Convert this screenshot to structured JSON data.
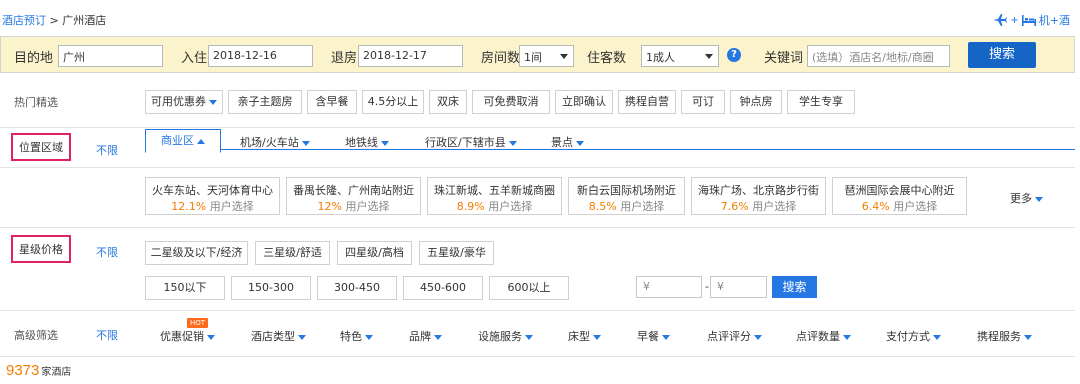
{
  "breadcrumb": {
    "link": "酒店预订",
    "separator": ">",
    "current": "广州酒店"
  },
  "header_right": {
    "label": "机+酒",
    "icons": [
      "airplane-icon",
      "bed-icon"
    ]
  },
  "search": {
    "destination_label": "目的地",
    "destination_value": "广州",
    "checkin_label": "入住",
    "checkin_value": "2018-12-16",
    "checkout_label": "退房",
    "checkout_value": "2018-12-17",
    "rooms_label": "房间数",
    "rooms_value": "1间",
    "guests_label": "住客数",
    "guests_value": "1成人",
    "keyword_label": "关键词",
    "keyword_placeholder": "(选填）酒店名/地标/商圈",
    "search_button": "搜索"
  },
  "hot": {
    "label": "热门精选",
    "chips": [
      "可用优惠券",
      "亲子主题房",
      "含早餐",
      "4.5分以上",
      "双床",
      "可免费取消",
      "立即确认",
      "携程自营",
      "可订",
      "钟点房",
      "学生专享"
    ]
  },
  "location": {
    "label": "位置区域",
    "unlimited": "不限",
    "tabs": [
      "商业区",
      "机场/火车站",
      "地铁线",
      "行政区/下辖市县",
      "景点"
    ],
    "user_choice_suffix": "用户选择",
    "areas": [
      {
        "name": "火车东站、天河体育中心",
        "percent": "12.1%"
      },
      {
        "name": "番禺长隆、广州南站附近",
        "percent": "12%"
      },
      {
        "name": "珠江新城、五羊新城商圈",
        "percent": "8.9%"
      },
      {
        "name": "新白云国际机场附近",
        "percent": "8.5%"
      },
      {
        "name": "海珠广场、北京路步行街",
        "percent": "7.6%"
      },
      {
        "name": "琶洲国际会展中心附近",
        "percent": "6.4%"
      }
    ],
    "more": "更多"
  },
  "star_price": {
    "label": "星级价格",
    "unlimited": "不限",
    "stars": [
      "二星级及以下/经济",
      "三星级/舒适",
      "四星级/高档",
      "五星级/豪华"
    ],
    "prices": [
      "150以下",
      "150-300",
      "300-450",
      "450-600",
      "600以上"
    ],
    "min_placeholder": "¥",
    "max_placeholder": "¥",
    "range_separator": "-",
    "search_button": "搜索"
  },
  "advanced": {
    "label": "高级筛选",
    "unlimited": "不限",
    "hot_badge": "HOT",
    "filters": [
      "优惠促销",
      "酒店类型",
      "特色",
      "品牌",
      "设施服务",
      "床型",
      "早餐",
      "点评评分",
      "点评数量",
      "支付方式",
      "携程服务"
    ]
  },
  "result": {
    "count": "9373",
    "unit": "家酒店"
  },
  "colors": {
    "accent": "#2577e3",
    "search_bar_bg": "#fbf3cc",
    "highlight_box": "#e0245e",
    "orange": "#f57c00"
  }
}
